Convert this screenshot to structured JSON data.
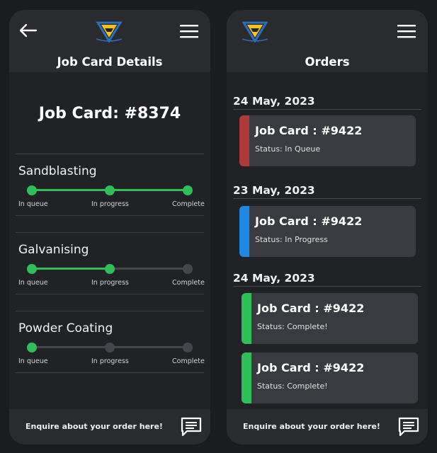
{
  "left_screen": {
    "header": {
      "title": "Job Card Details"
    },
    "job_card_title": "Job Card: #8374",
    "stages": [
      {
        "name": "Sandblasting",
        "progress_step": 3,
        "labels": [
          "In queue",
          "In progress",
          "Complete"
        ]
      },
      {
        "name": "Galvanising",
        "progress_step": 2,
        "labels": [
          "In queue",
          "In progress",
          "Complete"
        ]
      },
      {
        "name": "Powder Coating",
        "progress_step": 1,
        "labels": [
          "In queue",
          "In progress",
          "Complete"
        ]
      }
    ],
    "footer": {
      "text": "Enquire about your order here!"
    }
  },
  "right_screen": {
    "header": {
      "title": "Orders"
    },
    "groups": [
      {
        "date": "24 May, 2023",
        "orders": [
          {
            "title": "Job Card : #9422",
            "status": "Status: In Queue",
            "accent": "#b03a3a"
          }
        ]
      },
      {
        "date": "23 May, 2023",
        "orders": [
          {
            "title": "Job Card : #9422",
            "status": "Status: In Progress",
            "accent": "#1e88e5"
          }
        ]
      },
      {
        "date": "24 May, 2023",
        "orders": [
          {
            "title": "Job Card : #9422",
            "status": "Status: Complete!",
            "accent": "#2fbf57"
          },
          {
            "title": "Job Card : #9422",
            "status": "Status: Complete!",
            "accent": "#2fbf57"
          }
        ]
      }
    ],
    "footer": {
      "text": "Enquire about your order here!"
    }
  },
  "colors": {
    "progress_done": "#2fbf57",
    "progress_pending": "#45464b",
    "logo_yellow": "#f4c21b",
    "logo_blue": "#2b6fc0"
  },
  "icons": [
    "back-arrow-icon",
    "logo-icon",
    "menu-icon",
    "chat-icon"
  ]
}
